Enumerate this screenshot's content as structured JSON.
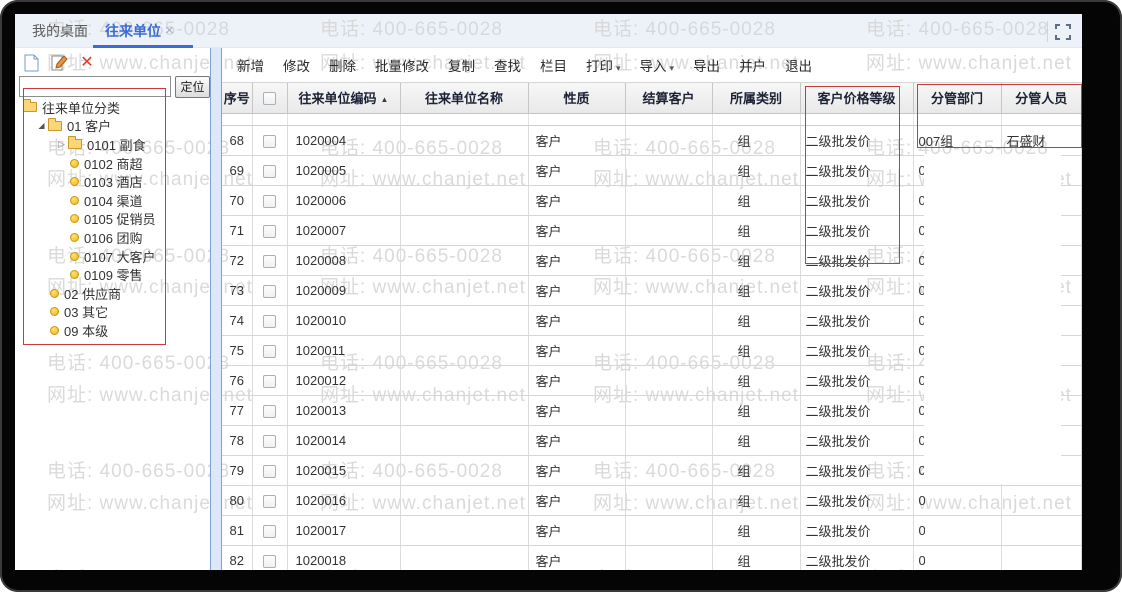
{
  "colors": {
    "accent_blue": "#3a6bd6",
    "annotation_red": "#c63c3c",
    "watermark_gray": "#d4d4d4",
    "splitter_blue": "#dce8f7"
  },
  "icons": {
    "close_tab": "×",
    "dropdown_caret": "▾",
    "sort_asc": "▲",
    "expander_expanded": "◢",
    "expander_collapsed": "▷",
    "delete_x": "✕"
  },
  "watermark": {
    "phone": "电话: 400-665-0028",
    "url": "网址: www.chanjet.net"
  },
  "tabs": [
    {
      "label": "我的桌面",
      "active": false
    },
    {
      "label": "往来单位",
      "active": true,
      "closable": true
    }
  ],
  "sidebar": {
    "search_value": "",
    "locate_button": "定位",
    "tree": [
      {
        "label": "往来单位分类",
        "level": 0,
        "icon": "folder-open",
        "expander": null
      },
      {
        "label": "01 客户",
        "level": 1,
        "icon": "folder",
        "expander": "expanded"
      },
      {
        "label": "0101 副食",
        "level": 2,
        "icon": "folder",
        "expander": "collapsed"
      },
      {
        "label": "0102 商超",
        "level": 2,
        "icon": "dot",
        "expander": null
      },
      {
        "label": "0103 酒店",
        "level": 2,
        "icon": "dot",
        "expander": null
      },
      {
        "label": "0104 渠道",
        "level": 2,
        "icon": "dot",
        "expander": null
      },
      {
        "label": "0105 促销员",
        "level": 2,
        "icon": "dot",
        "expander": null
      },
      {
        "label": "0106 团购",
        "level": 2,
        "icon": "dot",
        "expander": null
      },
      {
        "label": "0107 大客户",
        "level": 2,
        "icon": "dot",
        "expander": null
      },
      {
        "label": "0109 零售",
        "level": 2,
        "icon": "dot",
        "expander": null
      },
      {
        "label": "02 供应商",
        "level": 1,
        "icon": "dot",
        "expander": null
      },
      {
        "label": "03 其它",
        "level": 1,
        "icon": "dot",
        "expander": null
      },
      {
        "label": "09 本级",
        "level": 1,
        "icon": "dot",
        "expander": null
      }
    ]
  },
  "toolbar": {
    "items": [
      {
        "label": "新增"
      },
      {
        "label": "修改"
      },
      {
        "label": "删除"
      },
      {
        "label": "批量修改"
      },
      {
        "label": "复制"
      },
      {
        "label": "查找"
      },
      {
        "label": "栏目"
      },
      {
        "label": "打印",
        "dropdown": true
      },
      {
        "label": "导入",
        "dropdown": true
      },
      {
        "label": "导出"
      },
      {
        "label": "并户"
      },
      {
        "label": "退出"
      }
    ]
  },
  "table": {
    "columns": [
      {
        "label": "序号"
      },
      {
        "label": "",
        "checkbox": true
      },
      {
        "label": "往来单位编码",
        "sort": "asc"
      },
      {
        "label": "往来单位名称"
      },
      {
        "label": "性质"
      },
      {
        "label": "结算客户"
      },
      {
        "label": "所属类别"
      },
      {
        "label": "客户价格等级"
      },
      {
        "label": "分管部门"
      },
      {
        "label": "分管人员"
      }
    ],
    "rows": [
      {
        "seq": "68",
        "code": "1020004",
        "name": "",
        "nature": "客户",
        "settle": "",
        "category": "组",
        "price_level": "二级批发价",
        "dept": "007组",
        "person": "石盛财",
        "dept_clipped": false
      },
      {
        "seq": "69",
        "code": "1020005",
        "name": "",
        "nature": "客户",
        "settle": "",
        "category": "组",
        "price_level": "二级批发价",
        "dept": "0",
        "person": "",
        "dept_clipped": true
      },
      {
        "seq": "70",
        "code": "1020006",
        "name": "",
        "nature": "客户",
        "settle": "",
        "category": "组",
        "price_level": "二级批发价",
        "dept": "0",
        "person": "",
        "dept_clipped": true
      },
      {
        "seq": "71",
        "code": "1020007",
        "name": "",
        "nature": "客户",
        "settle": "",
        "category": "组",
        "price_level": "二级批发价",
        "dept": "0",
        "person": "",
        "dept_clipped": true
      },
      {
        "seq": "72",
        "code": "1020008",
        "name": "",
        "nature": "客户",
        "settle": "",
        "category": "组",
        "price_level": "二级批发价",
        "dept": "0",
        "person": "",
        "dept_clipped": true
      },
      {
        "seq": "73",
        "code": "1020009",
        "name": "",
        "nature": "客户",
        "settle": "",
        "category": "组",
        "price_level": "二级批发价",
        "dept": "0",
        "person": "",
        "dept_clipped": true
      },
      {
        "seq": "74",
        "code": "1020010",
        "name": "",
        "nature": "客户",
        "settle": "",
        "category": "组",
        "price_level": "二级批发价",
        "dept": "0",
        "person": "",
        "dept_clipped": true
      },
      {
        "seq": "75",
        "code": "1020011",
        "name": "",
        "nature": "客户",
        "settle": "",
        "category": "组",
        "price_level": "二级批发价",
        "dept": "0",
        "person": "",
        "dept_clipped": true
      },
      {
        "seq": "76",
        "code": "1020012",
        "name": "",
        "nature": "客户",
        "settle": "",
        "category": "组",
        "price_level": "二级批发价",
        "dept": "0",
        "person": "",
        "dept_clipped": true
      },
      {
        "seq": "77",
        "code": "1020013",
        "name": "",
        "nature": "客户",
        "settle": "",
        "category": "组",
        "price_level": "二级批发价",
        "dept": "0",
        "person": "",
        "dept_clipped": true
      },
      {
        "seq": "78",
        "code": "1020014",
        "name": "",
        "nature": "客户",
        "settle": "",
        "category": "组",
        "price_level": "二级批发价",
        "dept": "0",
        "person": "",
        "dept_clipped": true
      },
      {
        "seq": "79",
        "code": "1020015",
        "name": "",
        "nature": "客户",
        "settle": "",
        "category": "组",
        "price_level": "二级批发价",
        "dept": "0",
        "person": "",
        "dept_clipped": true
      },
      {
        "seq": "80",
        "code": "1020016",
        "name": "",
        "nature": "客户",
        "settle": "",
        "category": "组",
        "price_level": "二级批发价",
        "dept": "0",
        "person": "",
        "dept_clipped": true
      },
      {
        "seq": "81",
        "code": "1020017",
        "name": "",
        "nature": "客户",
        "settle": "",
        "category": "组",
        "price_level": "二级批发价",
        "dept": "0",
        "person": "",
        "dept_clipped": true
      },
      {
        "seq": "82",
        "code": "1020018",
        "name": "",
        "nature": "客户",
        "settle": "",
        "category": "组",
        "price_level": "二级批发价",
        "dept": "0",
        "person": "",
        "dept_clipped": true
      }
    ]
  }
}
